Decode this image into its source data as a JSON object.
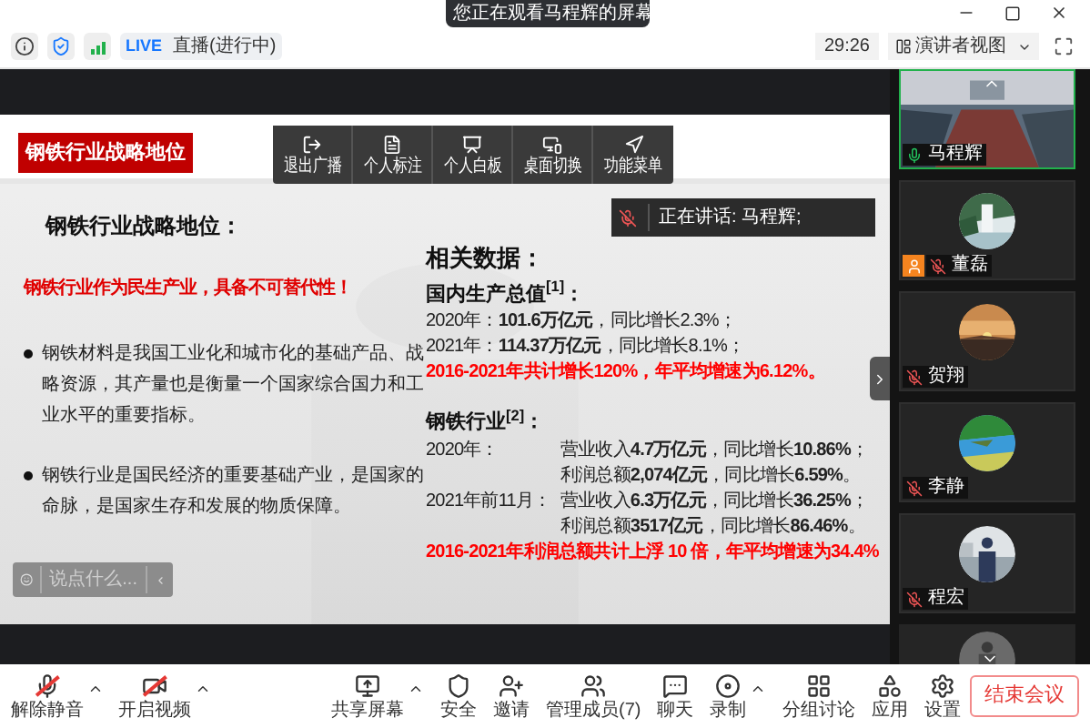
{
  "banner": {
    "text": "您正在观看马程辉的屏幕"
  },
  "status_bar": {
    "live_badge": "LIVE",
    "live_status": "直播(进行中)",
    "timer": "29:26",
    "view_mode": "演讲者视图"
  },
  "slide": {
    "title": "钢铁行业战略地位",
    "heading": "钢铁行业战略地位：",
    "slogan": "钢铁行业作为民生产业，具备不可替代性！",
    "bullets": [
      "钢铁材料是我国工业化和城市化的基础产品、战略资源，其产量也是衡量一个国家综合国力和工业水平的重要指标。",
      "钢铁行业是国民经济的重要基础产业，是国家的命脉，是国家生存和发展的物质保障。"
    ],
    "data_heading": "相关数据：",
    "sections": [
      {
        "title": "国内生产总值$^{[1]}$：",
        "rows": [
          {
            "kind": "normal",
            "text": "2020年：**101.6万亿元**，同比增长2.3%；"
          },
          {
            "kind": "normal",
            "text": "2021年：**114.37万亿元**，同比增长8.1%；"
          },
          {
            "kind": "highlight",
            "text": "2016-2021年共计增长120%，年平均增速为6.12%。"
          }
        ]
      },
      {
        "title": "钢铁行业$^{[2]}$：",
        "rows": [
          {
            "kind": "normal",
            "label": "2020年：",
            "text": "营业收入**4.7万亿元**，同比增长**10.86%**；"
          },
          {
            "kind": "normal",
            "text": "利润总额**2,074亿元**，同比增长**6.59%**。"
          },
          {
            "kind": "normal",
            "label": "2021年前11月：",
            "text": "营业收入**6.3万亿元**，同比增长**36.25%**；"
          },
          {
            "kind": "normal",
            "text": "利润总额**3517亿元**，同比增长**86.46%**。"
          },
          {
            "kind": "highlight",
            "text": "2016-2021年利润总额共计上浮 10 倍，年平均增速为34.4%"
          }
        ]
      }
    ]
  },
  "slide_toolbar": [
    {
      "label": "退出广播"
    },
    {
      "label": "个人标注"
    },
    {
      "label": "个人白板"
    },
    {
      "label": "桌面切换"
    },
    {
      "label": "功能菜单"
    }
  ],
  "speaking": "正在讲话: 马程辉;",
  "comment": {
    "placeholder": "说点什么..."
  },
  "participants": [
    {
      "name": "马程辉",
      "kind": "video",
      "speaking": true,
      "muted": false,
      "host": false
    },
    {
      "name": "董磊",
      "kind": "avatar",
      "speaking": false,
      "muted": true,
      "host": true
    },
    {
      "name": "贺翔",
      "kind": "avatar",
      "speaking": false,
      "muted": true,
      "host": false
    },
    {
      "name": "李静",
      "kind": "avatar",
      "speaking": false,
      "muted": true,
      "host": false
    },
    {
      "name": "程宏",
      "kind": "avatar",
      "speaking": false,
      "muted": true,
      "host": false
    }
  ],
  "toolbar": [
    {
      "label": "解除静音",
      "off": true,
      "has_menu": true
    },
    {
      "label": "开启视频",
      "off": true,
      "has_menu": true
    },
    {
      "label": "共享屏幕",
      "off": false,
      "has_menu": true
    },
    {
      "label": "安全",
      "off": false,
      "has_menu": false
    },
    {
      "label": "邀请",
      "off": false,
      "has_menu": false
    },
    {
      "label": "管理成员(7)",
      "off": false,
      "has_menu": false
    },
    {
      "label": "聊天",
      "off": false,
      "has_menu": false
    },
    {
      "label": "录制",
      "off": false,
      "has_menu": true
    },
    {
      "label": "分组讨论",
      "off": false,
      "has_menu": false
    },
    {
      "label": "应用",
      "off": false,
      "has_menu": false
    },
    {
      "label": "设置",
      "off": false,
      "has_menu": false
    }
  ],
  "end_button": "结束会议"
}
